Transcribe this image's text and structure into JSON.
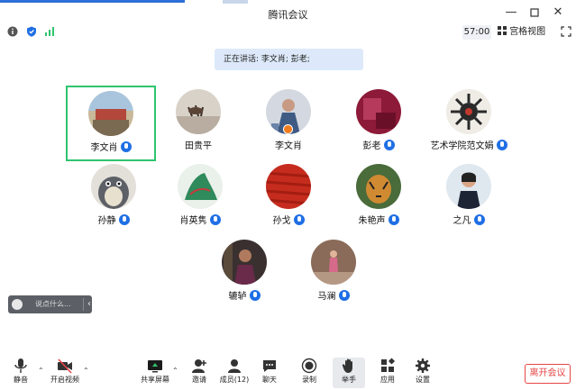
{
  "window": {
    "title": "腾讯会议",
    "controls": [
      "minimize-icon",
      "maximize-icon",
      "close-icon"
    ]
  },
  "infobar": {
    "timer": "57:00",
    "view_mode": "宫格视图"
  },
  "speaking": {
    "text": "正在讲话: 李文肖; 彭老;"
  },
  "participants": [
    {
      "name": "李文肖",
      "active": true,
      "mic": true
    },
    {
      "name": "田贵平",
      "mic": false
    },
    {
      "name": "李文肖",
      "mic": false
    },
    {
      "name": "彭老",
      "mic": true
    },
    {
      "name": "艺术学院范文娟",
      "mic": true
    },
    {
      "name": "孙静",
      "mic": true
    },
    {
      "name": "肖英隽",
      "mic": true
    },
    {
      "name": "孙戈",
      "mic": true
    },
    {
      "name": "朱艳声",
      "mic": true
    },
    {
      "name": "之凡",
      "mic": true
    },
    {
      "name": "辘轳",
      "mic": true
    },
    {
      "name": "马澜",
      "mic": true
    }
  ],
  "chat": {
    "placeholder": "说点什么..."
  },
  "toolbar": {
    "mute": "静音",
    "video": "开启视频",
    "share": "共享屏幕",
    "invite": "邀请",
    "members": "成员(12)",
    "chat": "聊天",
    "record": "录制",
    "raise_hand": "举手",
    "apps": "应用",
    "settings": "设置",
    "leave": "离开会议"
  },
  "colors": {
    "accent": "#1f6fe5",
    "active_border": "#2ec46e",
    "leave": "#e54545",
    "banner": "#dde9fa"
  }
}
